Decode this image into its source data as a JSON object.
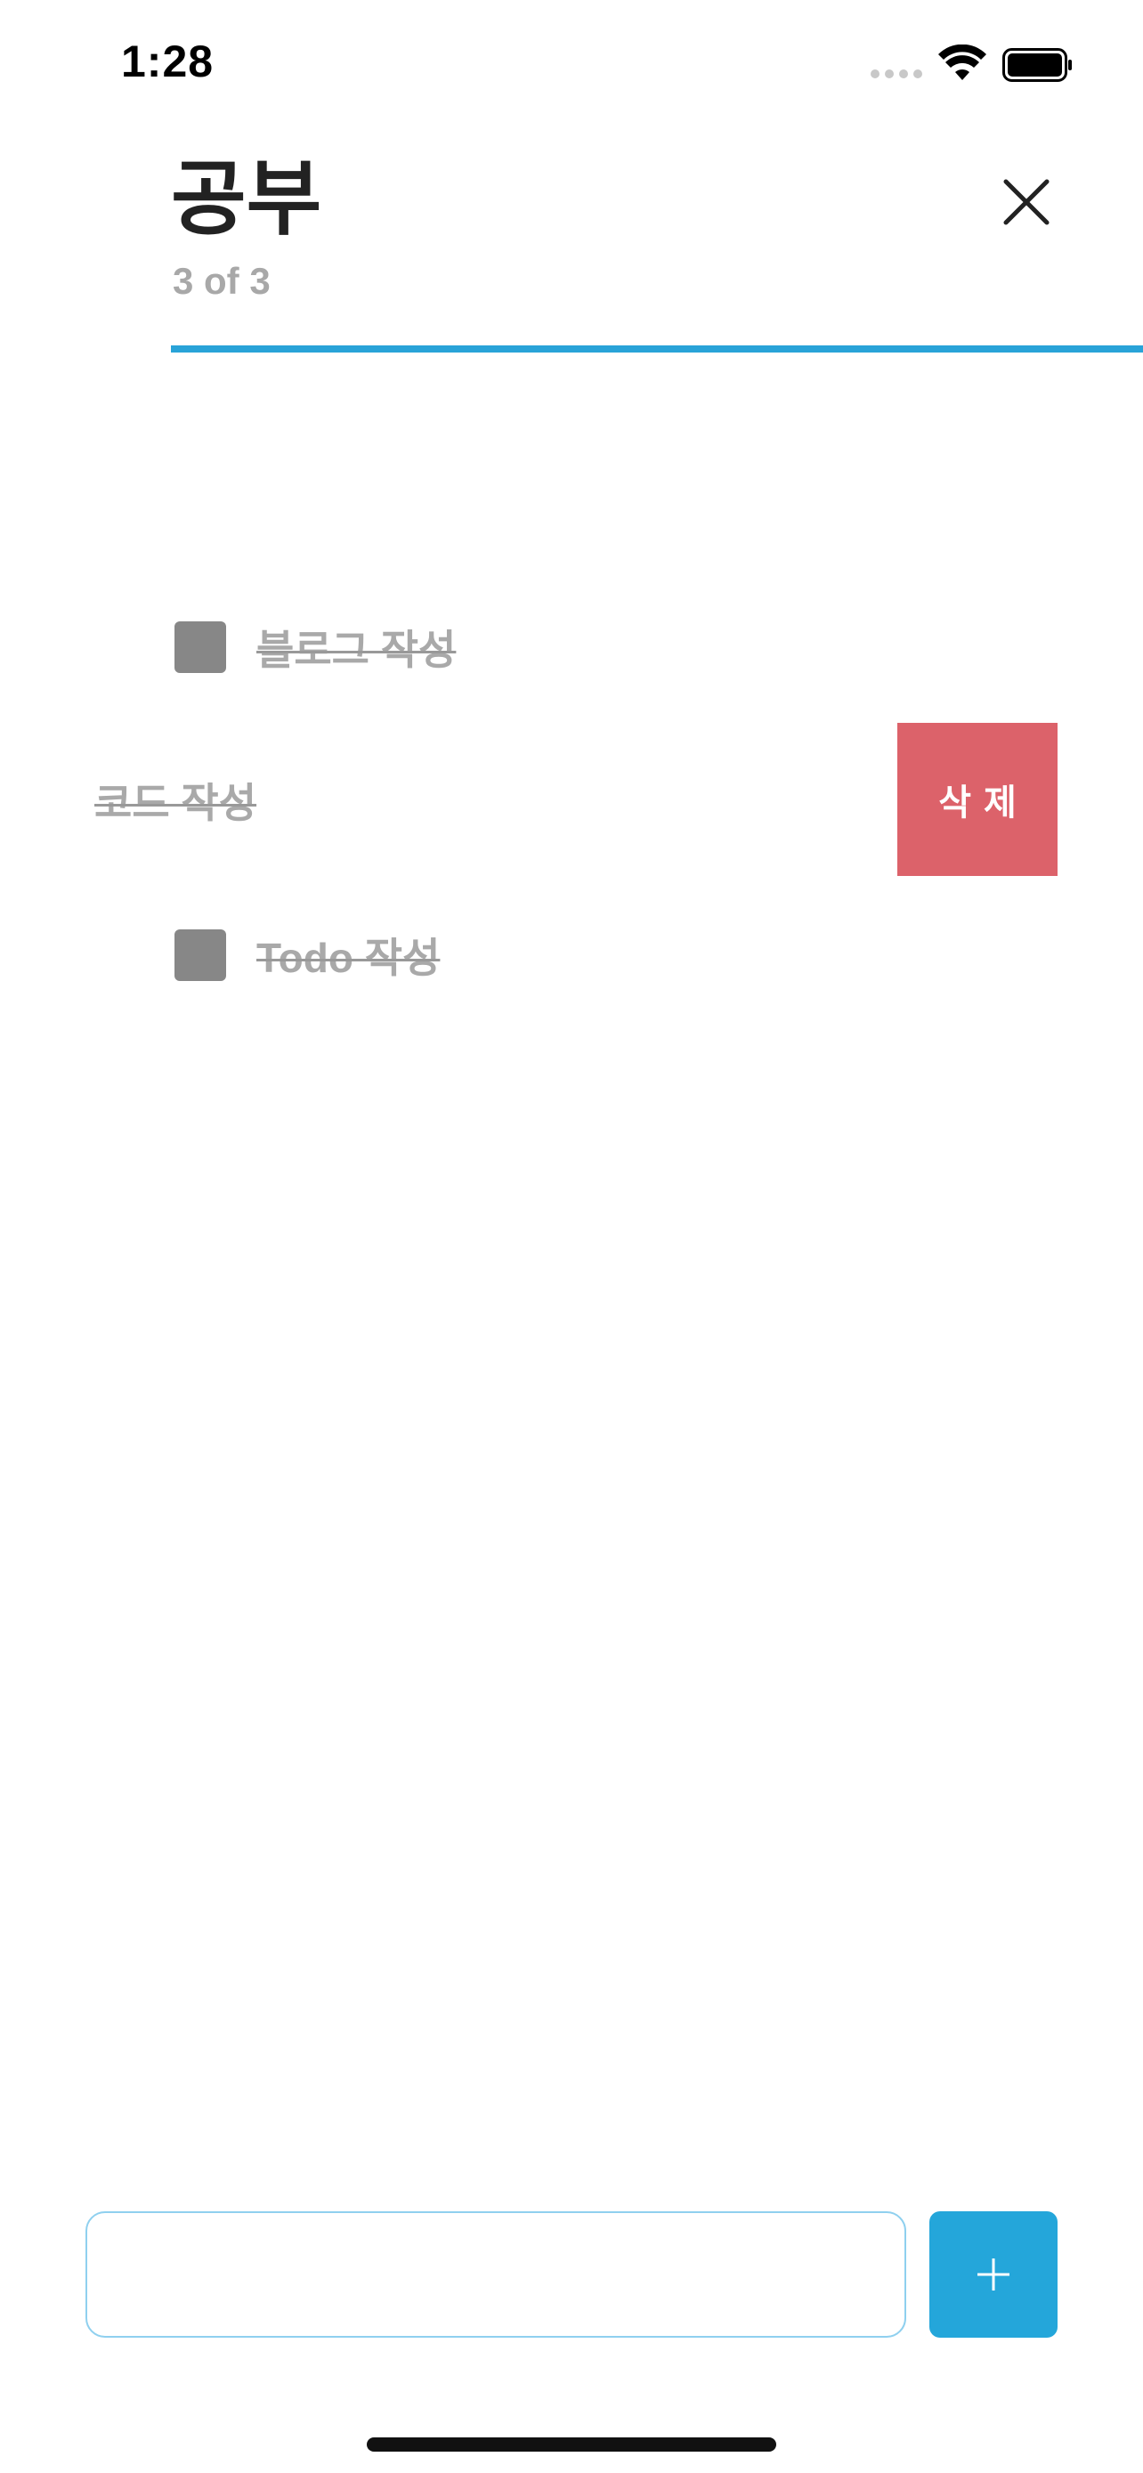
{
  "status_bar": {
    "time": "1:28"
  },
  "header": {
    "title": "공부",
    "subtitle": "3 of 3",
    "close_icon": "close-icon",
    "progress_fraction": 1.0,
    "accent_color": "#29a3d8"
  },
  "todos": [
    {
      "label": "블로그 작성",
      "checked": true
    },
    {
      "label": "코드 작성",
      "checked": true,
      "swiped": true
    },
    {
      "label": "Todo 작성",
      "checked": true
    }
  ],
  "swipe_action": {
    "delete_label": "삭제",
    "color": "#dc626a"
  },
  "composer": {
    "input_value": "",
    "input_placeholder": "",
    "add_icon": "plus-icon",
    "add_button_color": "#24a6da"
  }
}
